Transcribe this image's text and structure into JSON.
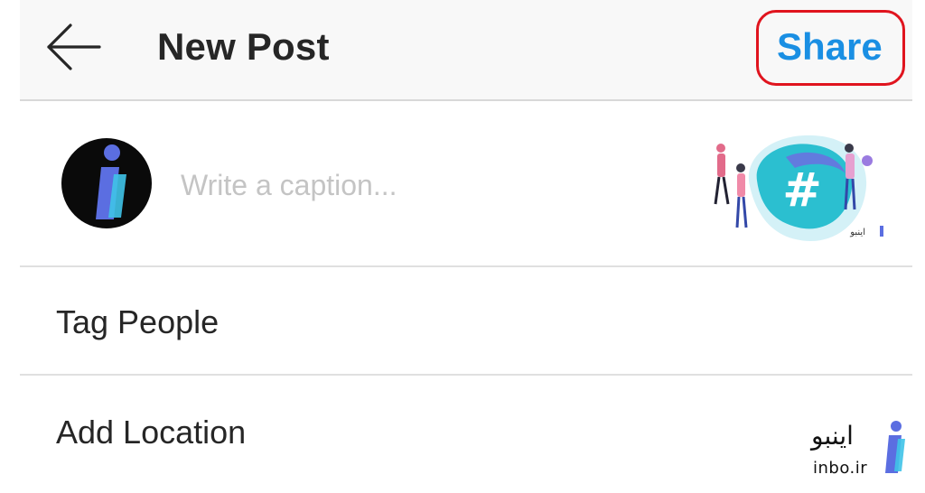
{
  "header": {
    "title": "New Post",
    "share_label": "Share",
    "back_icon": "arrow-left-icon",
    "accent_color": "#1a8fe3",
    "highlight_color": "#e0141e"
  },
  "caption": {
    "placeholder": "Write a caption...",
    "value": ""
  },
  "options": {
    "tag_people": "Tag People",
    "add_location": "Add Location"
  },
  "thumbnail": {
    "hashtag_symbol": "#",
    "logo_text": "اینبو"
  },
  "watermark": {
    "text_fa": "اینبو",
    "text_en": "inbo.ir"
  }
}
